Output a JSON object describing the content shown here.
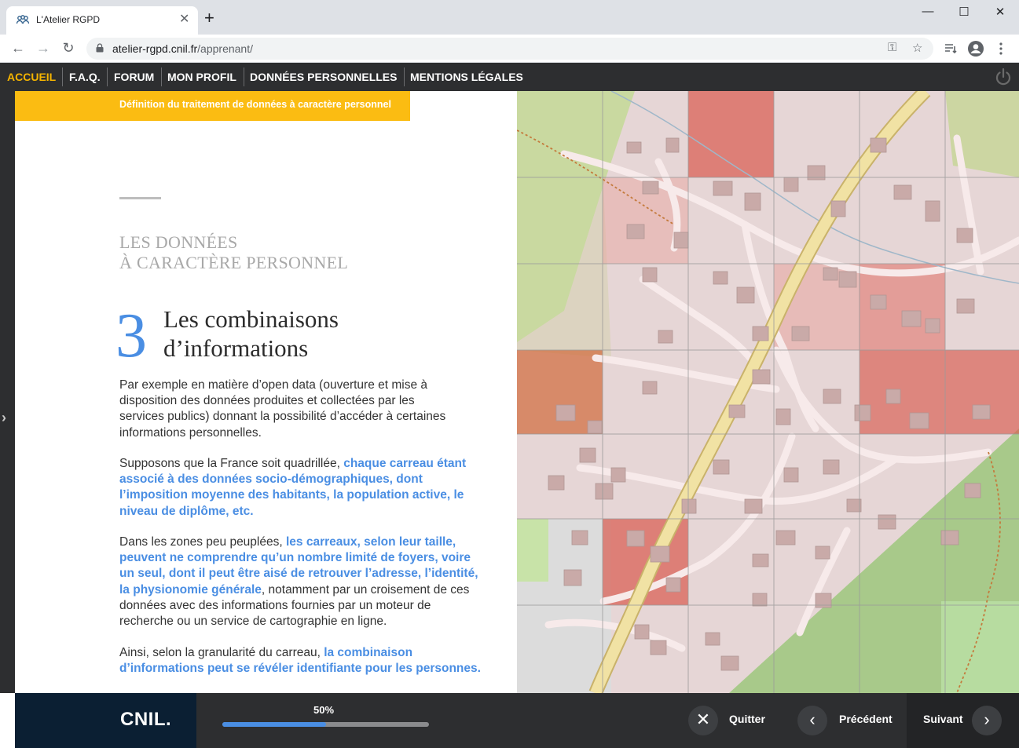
{
  "browser": {
    "tab_title": "L'Atelier RGPD",
    "url_host": "atelier-rgpd.cnil.fr",
    "url_path": "/apprenant/",
    "new_tab": "+",
    "tab_close": "✕"
  },
  "nav": {
    "items": [
      "ACCUEIL",
      "F.A.Q.",
      "FORUM",
      "MON PROFIL",
      "DONNÉES PERSONNELLES",
      "MENTIONS LÉGALES"
    ],
    "active": "ACCUEIL",
    "accent": "#f5b400"
  },
  "content": {
    "banner": "Définition du traitement de données à caractère personnel",
    "overline_1": "LES DONNÉES",
    "overline_2": "À CARACTÈRE PERSONNEL",
    "number": "3",
    "title_1": "Les combinaisons",
    "title_2": "d’informations",
    "p1": "Par exemple en matière d’open data (ouverture et mise à disposition des données produites et collectées par les services publics) donnant la possibilité d’accéder à certaines informations personnelles.",
    "p2_plain": "Supposons que la France soit quadrillée, ",
    "p2_highlight": "chaque carreau étant associé à des données socio-démographiques, dont l’imposition moyenne des habitants, la population active, le niveau de diplôme, etc.",
    "p3_plain_a": "Dans les zones peu peuplées, ",
    "p3_highlight": "les carreaux, selon leur taille, peuvent ne comprendre qu’un nombre limité de foyers, voire un seul, dont il peut être aisé de retrouver l’adresse, l’identité, la physionomie générale",
    "p3_plain_b": ", notamment par un croisement de ces données avec des informations fournies par un moteur de recherche ou un service de cartographie en ligne.",
    "p4_plain": "Ainsi, selon la granularité du carreau, ",
    "p4_highlight": "la combinaison d’informations peut se révéler identifiante pour les personnes.",
    "highlight_color": "#4a8ee3",
    "banner_color": "#fbbc12"
  },
  "footer": {
    "logo": "CNIL.",
    "progress_label": "50%",
    "progress": 0.5,
    "quit": "Quitter",
    "prev": "Précédent",
    "next": "Suivant"
  },
  "icons": {
    "back": "arrow-left-icon",
    "forward": "arrow-right-icon",
    "reload": "reload-icon",
    "lock": "lock-icon",
    "key": "key-icon",
    "star": "star-icon",
    "queue": "playlist-icon",
    "profile": "account-circle-icon",
    "menu": "more-vert-icon",
    "power": "power-icon"
  }
}
